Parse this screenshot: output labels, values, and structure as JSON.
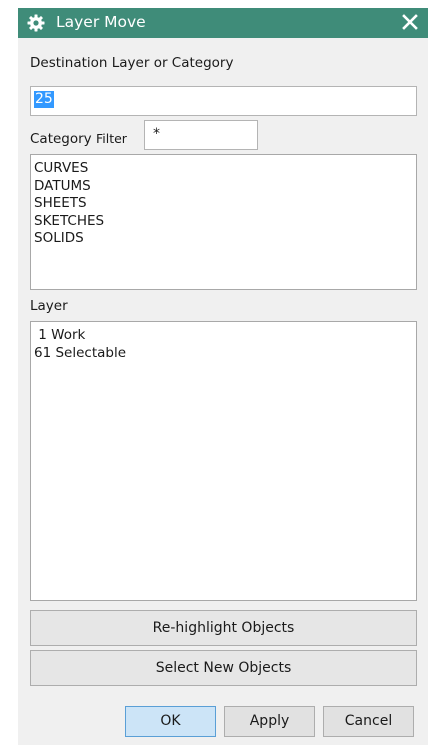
{
  "window": {
    "title": "Layer Move",
    "title_icon": "gear-icon",
    "close_icon": "close-icon"
  },
  "destination": {
    "label": "Destination Layer or Category",
    "value": "25"
  },
  "category_filter": {
    "label_part1": "Category",
    "label_part2": "Filter",
    "value": "*"
  },
  "categories": [
    {
      "label": "CURVES"
    },
    {
      "label": "DATUMS"
    },
    {
      "label": "SHEETS"
    },
    {
      "label": "SKETCHES"
    },
    {
      "label": "SOLIDS"
    }
  ],
  "layer_section": {
    "label": "Layer",
    "items": [
      {
        "label": " 1 Work"
      },
      {
        "label": "61 Selectable"
      }
    ]
  },
  "actions": {
    "rehighlight": "Re-highlight Objects",
    "select_new": "Select New Objects"
  },
  "footer": {
    "ok": "OK",
    "apply": "Apply",
    "cancel": "Cancel"
  },
  "colors": {
    "titlebar": "#3f8c79",
    "selection": "#3399ff",
    "primary_button": "#cce4f7"
  }
}
